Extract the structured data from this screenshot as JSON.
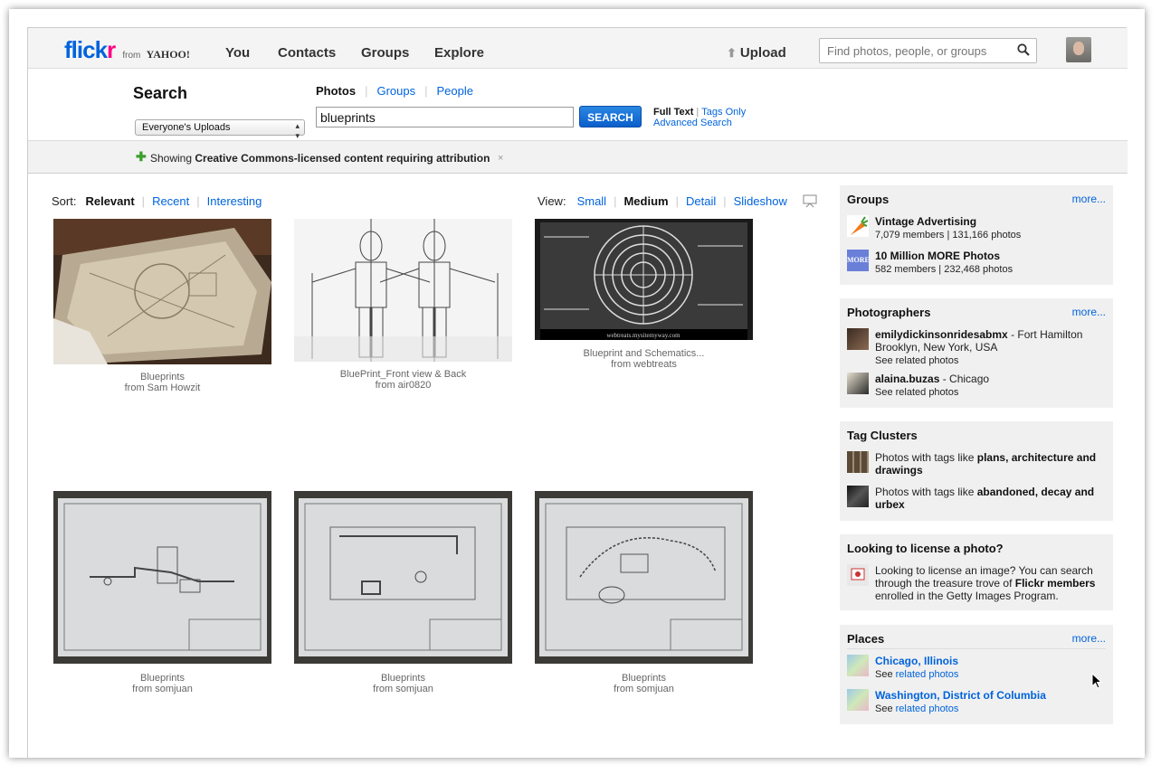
{
  "header": {
    "logo_flick": "flick",
    "logo_r": "r",
    "logo_from": "from",
    "logo_yahoo": "YAHOO!",
    "nav": [
      "You",
      "Contacts",
      "Groups",
      "Explore"
    ],
    "upload_label": "Upload",
    "search_placeholder": "Find photos, people, or groups"
  },
  "search": {
    "title": "Search",
    "scope_value": "Everyone's Uploads",
    "tabs": [
      "Photos",
      "Groups",
      "People"
    ],
    "active_tab": "Photos",
    "query": "blueprints",
    "button_label": "SEARCH",
    "full_text": "Full Text",
    "tags_only": "Tags Only",
    "advanced": "Advanced Search"
  },
  "cc_notice": {
    "showing": "Showing ",
    "bold": "Creative Commons-licensed content requiring attribution",
    "close": "×"
  },
  "sort": {
    "label": "Sort:",
    "options": [
      "Relevant",
      "Recent",
      "Interesting"
    ],
    "active": "Relevant"
  },
  "view": {
    "label": "View:",
    "options": [
      "Small",
      "Medium",
      "Detail",
      "Slideshow"
    ],
    "active": "Medium"
  },
  "photos": [
    {
      "title": "Blueprints",
      "from": "from Sam Howzit"
    },
    {
      "title": "BluePrint_Front view & Back",
      "from": "from air0820"
    },
    {
      "title": "Blueprint and Schematics...",
      "from": "from webtreats"
    },
    {
      "title": "Blueprints",
      "from": "from somjuan"
    },
    {
      "title": "Blueprints",
      "from": "from somjuan"
    },
    {
      "title": "Blueprints",
      "from": "from somjuan"
    }
  ],
  "photo3_watermark": "webtreats.mysitemyway.com",
  "sidebar": {
    "groups": {
      "title": "Groups",
      "more": "more...",
      "items": [
        {
          "name": "Vintage Advertising",
          "stats": "7,079 members | 131,166 photos",
          "icon": "carrot-icon"
        },
        {
          "name": "10 Million MORE Photos",
          "stats": "582 members | 232,468 photos",
          "icon": "more-icon",
          "icon_text": "MORE"
        }
      ]
    },
    "photographers": {
      "title": "Photographers",
      "more": "more...",
      "items": [
        {
          "name": "emilydickinsonridesabmx",
          "loc": " - Fort Hamilton Brooklyn, New York, USA",
          "see": "See related photos"
        },
        {
          "name": "alaina.buzas",
          "loc": " - Chicago",
          "see": "See related photos"
        }
      ]
    },
    "tag_clusters": {
      "title": "Tag Clusters",
      "items": [
        {
          "prefix": "Photos with tags like ",
          "tags": "plans, architecture and drawings"
        },
        {
          "prefix": "Photos with tags like ",
          "tags": "abandoned, decay and urbex"
        }
      ]
    },
    "license": {
      "title": "Looking to license a photo?",
      "text1": "Looking to license an image? You can search through the treasure trove of ",
      "bold": "Flickr members",
      "text2": " enrolled in the Getty Images Program."
    },
    "places": {
      "title": "Places",
      "more": "more...",
      "items": [
        {
          "name": "Chicago, Illinois",
          "see": "See ",
          "link": "related photos"
        },
        {
          "name": "Washington, District of Columbia",
          "see": "See ",
          "link": "related photos"
        }
      ]
    }
  },
  "colors": {
    "link": "#0063dc",
    "brand_pink": "#ff0084",
    "button_blue": "#0b5fcb"
  }
}
